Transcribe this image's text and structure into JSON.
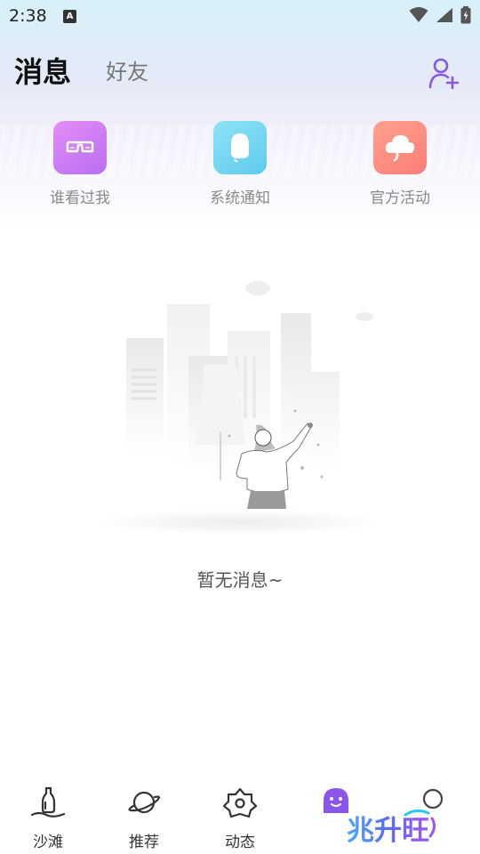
{
  "status_bar": {
    "time": "2:38",
    "notification_letter": "A"
  },
  "header": {
    "active_tab": "消息",
    "inactive_tab": "好友"
  },
  "shortcuts": [
    {
      "label": "谁看过我",
      "icon": "glasses-icon"
    },
    {
      "label": "系统通知",
      "icon": "bell-icon"
    },
    {
      "label": "官方活动",
      "icon": "cloud-icon"
    }
  ],
  "empty_state": {
    "text": "暂无消息~"
  },
  "bottom_nav": {
    "items": [
      {
        "label": "沙滩",
        "icon": "beach-bottle-icon"
      },
      {
        "label": "推荐",
        "icon": "planet-icon"
      },
      {
        "label": "动态",
        "icon": "flower-icon"
      },
      {
        "label": "",
        "icon": "message-face-icon"
      },
      {
        "label": "",
        "icon": "profile-circle-icon"
      }
    ],
    "brand_text": "兆升旺"
  },
  "colors": {
    "accent_purple": "#8a56e8",
    "tile_pink_purple": "#c97af3",
    "tile_cyan": "#6fd3f1",
    "tile_coral": "#fc8a7f"
  }
}
